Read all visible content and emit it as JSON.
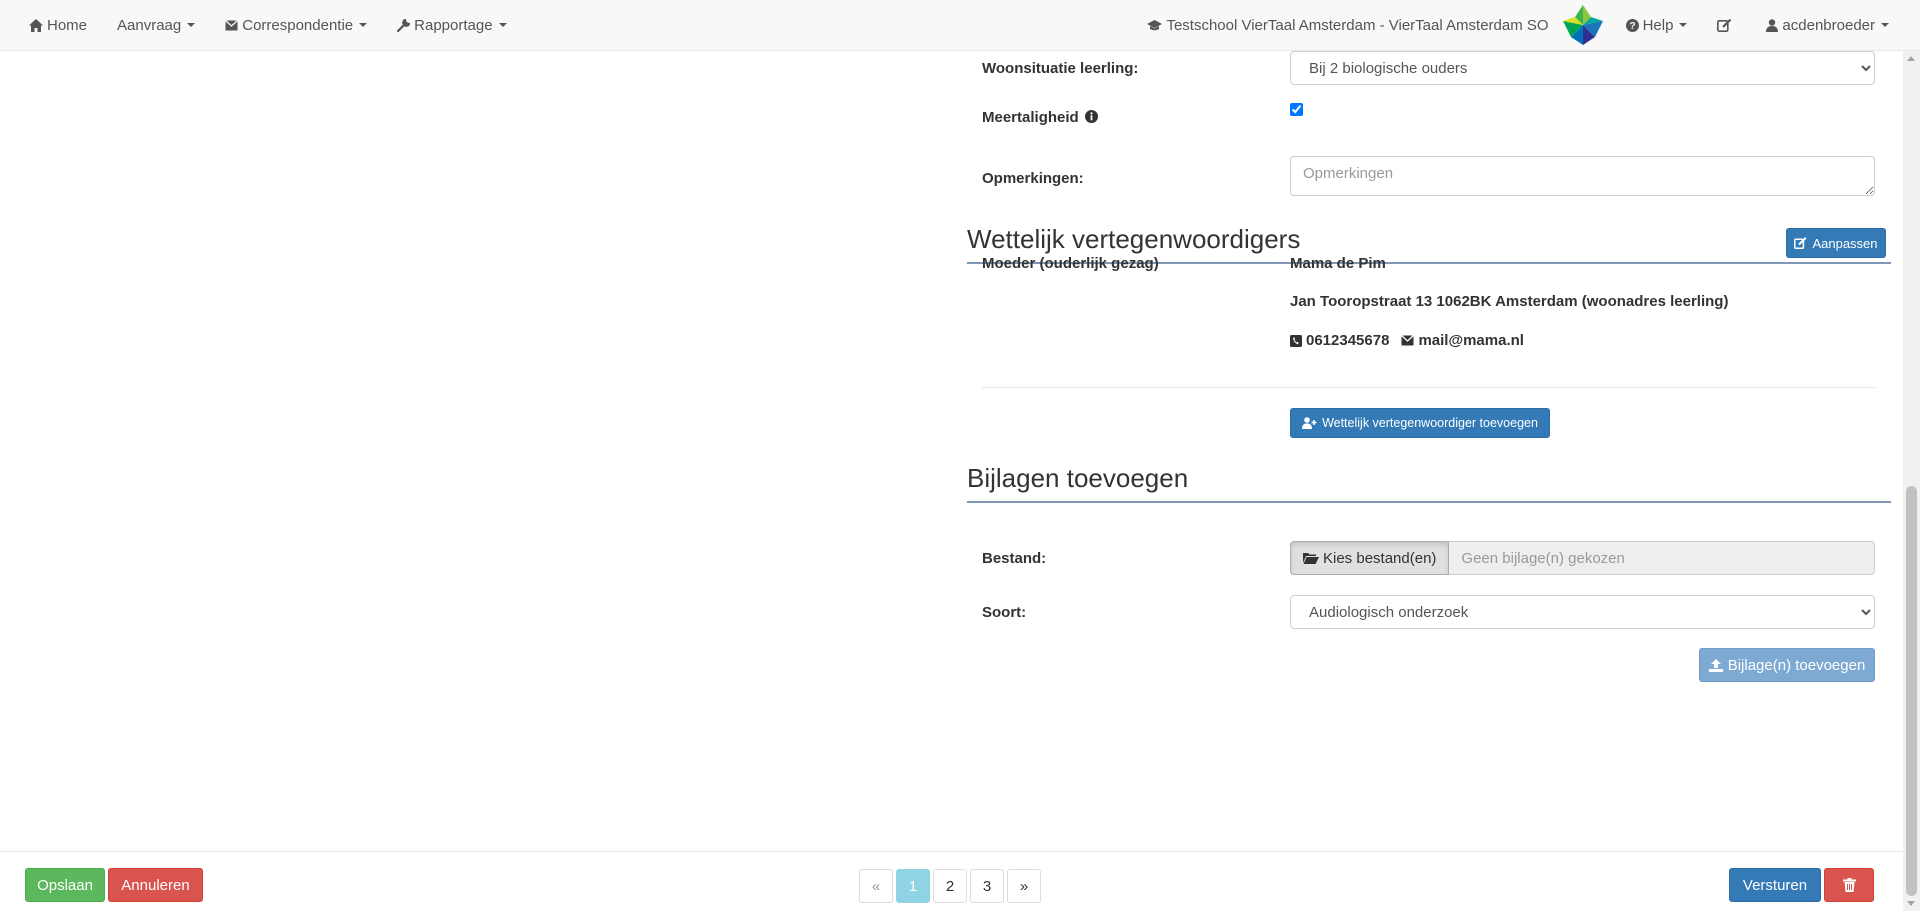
{
  "navbar": {
    "home": "Home",
    "aanvraag": "Aanvraag",
    "correspondentie": "Correspondentie",
    "rapportage": "Rapportage",
    "school": "Testschool VierTaal Amsterdam - VierTaal Amsterdam SO",
    "help": "Help",
    "user": "acdenbroeder"
  },
  "form": {
    "woonsituatie_label": "Woonsituatie leerling:",
    "woonsituatie_value": "Bij 2 biologische ouders",
    "meertaligheid_label": "Meertaligheid",
    "meertaligheid_checked": true,
    "opmerkingen_label": "Opmerkingen:",
    "opmerkingen_placeholder": "Opmerkingen"
  },
  "vertegenwoordigers": {
    "title": "Wettelijk vertegenwoordigers",
    "edit_button": "Aanpassen",
    "role": "Moeder (ouderlijk gezag)",
    "name": "Mama de Pim",
    "address": "Jan Tooropstraat 13 1062BK Amsterdam (woonadres leerling)",
    "phone": "0612345678",
    "email": "mail@mama.nl",
    "add_button": "Wettelijk vertegenwoordiger toevoegen"
  },
  "bijlagen": {
    "title": "Bijlagen toevoegen",
    "bestand_label": "Bestand:",
    "choose_button": "Kies bestand(en)",
    "no_file_text": "Geen bijlage(n) gekozen",
    "soort_label": "Soort:",
    "soort_value": "Audiologisch onderzoek",
    "upload_button": "Bijlage(n) toevoegen"
  },
  "footer": {
    "save_button": "Opslaan",
    "cancel_button": "Annuleren",
    "pages": {
      "prev": "«",
      "p1": "1",
      "p2": "2",
      "p3": "3",
      "next": "»"
    },
    "send_button": "Versturen"
  },
  "colors": {
    "primary": "#337ab7",
    "success": "#5cb85c",
    "danger": "#d9534f",
    "active_page": "#8fd3e4"
  }
}
